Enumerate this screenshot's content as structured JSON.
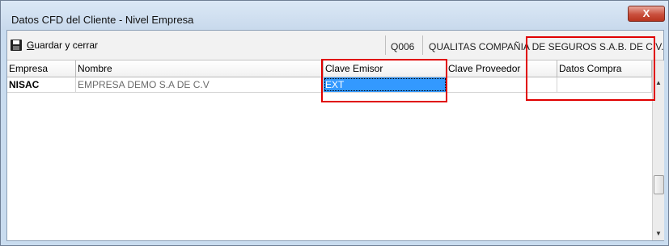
{
  "window": {
    "title": "Datos CFD del Cliente - Nivel Empresa",
    "close_glyph": "X"
  },
  "toolbar": {
    "save_label_mnemonic": "G",
    "save_label_rest": "uardar y cerrar",
    "client_code": "Q006",
    "client_name": "QUALITAS COMPAÑIA DE SEGUROS S.A.B.  DE C.V."
  },
  "grid": {
    "columns": [
      "Empresa",
      "Nombre",
      "Clave Emisor",
      "Clave Proveedor",
      "Datos Compra"
    ],
    "rows": [
      {
        "empresa": "NISAC",
        "nombre": "EMPRESA DEMO S.A DE C.V",
        "clave_emisor": "EXT",
        "clave_proveedor": "",
        "datos_compra": ""
      }
    ]
  },
  "scrollbar": {
    "up_glyph": "▲",
    "down_glyph": "▼"
  },
  "colors": {
    "selection": "#3399ff",
    "annotation": "#e00000"
  }
}
